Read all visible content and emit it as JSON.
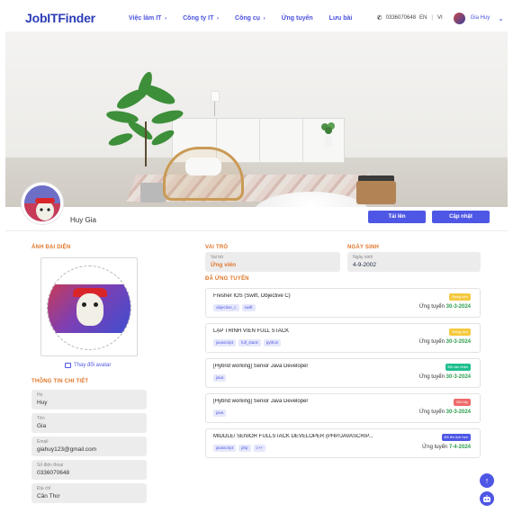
{
  "nav": {
    "logo": "JobITFinder",
    "items": [
      {
        "label": "Việc làm IT",
        "dropdown": true
      },
      {
        "label": "Công ty IT",
        "dropdown": true
      },
      {
        "label": "Công cụ",
        "dropdown": true
      },
      {
        "label": "Ứng tuyển",
        "dropdown": false
      },
      {
        "label": "Lưu bài",
        "dropdown": false
      }
    ],
    "phone": "0336070648",
    "lang_en": "EN",
    "lang_vi": "VI",
    "user_name": "Gia Huy"
  },
  "profile": {
    "name": "Huy Gia",
    "upload_label": "Tải lên",
    "update_label": "Cập nhật"
  },
  "left": {
    "avatar_section_label": "ẢNH ĐẠI DIỆN",
    "change_avatar_label": "Thay đổi avatar",
    "details_section_label": "THÔNG TIN CHI TIẾT",
    "fields": [
      {
        "label": "Họ",
        "value": "Huy"
      },
      {
        "label": "Tên",
        "value": "Gia"
      },
      {
        "label": "Email",
        "value": "giahuy123@gmail.com"
      },
      {
        "label": "Số điện thoại",
        "value": "0336070648"
      },
      {
        "label": "Địa chỉ",
        "value": "Cần Thơ"
      }
    ]
  },
  "right": {
    "role_section_label": "VAI TRÒ",
    "role_field_label": "Vai trò",
    "role_value": "Ứng viên",
    "birth_section_label": "NGÀY SINH",
    "birth_field_label": "Ngày sinh",
    "birth_value": "4-9-2002",
    "applied_section_label": "ĐÃ ỨNG TUYỂN",
    "applied_prefix": "Ứng tuyển",
    "jobs": [
      {
        "title": "Fresher IOS (Swift, Objective C)",
        "tags": [
          "objective_c",
          "swift"
        ],
        "status": "Đang chờ",
        "status_color": "#f5c93f",
        "date": "30-3-2024"
      },
      {
        "title": "LẬP TRÌNH VIÊN FULL STACK",
        "tags": [
          "javascript",
          "full_stack",
          "python"
        ],
        "status": "Đang chờ",
        "status_color": "#f5c93f",
        "date": "30-3-2024"
      },
      {
        "title": "[Hybrid working] Senior Java Developer",
        "tags": [
          "java"
        ],
        "status": "Đã xác nhận",
        "status_color": "#1fbf8f",
        "date": "30-3-2024"
      },
      {
        "title": "[Hybrid working] Senior Java Developer",
        "tags": [
          "java"
        ],
        "status": "Đã hủy",
        "status_color": "#ee6b6b",
        "date": "30-3-2024"
      },
      {
        "title": "MIDDLE/ SENIOR FULLSTACK DEVELOPER (PHP/JAVASCRIP...",
        "tags": [
          "javascript",
          "php",
          "c++"
        ],
        "status": "Đã lên lịch hẹn",
        "status_color": "#4e57e5",
        "date": "7-4-2024"
      }
    ]
  },
  "floating": {
    "scroll_top_icon": "arrow-up-icon",
    "chatbot_icon": "robot-icon"
  }
}
